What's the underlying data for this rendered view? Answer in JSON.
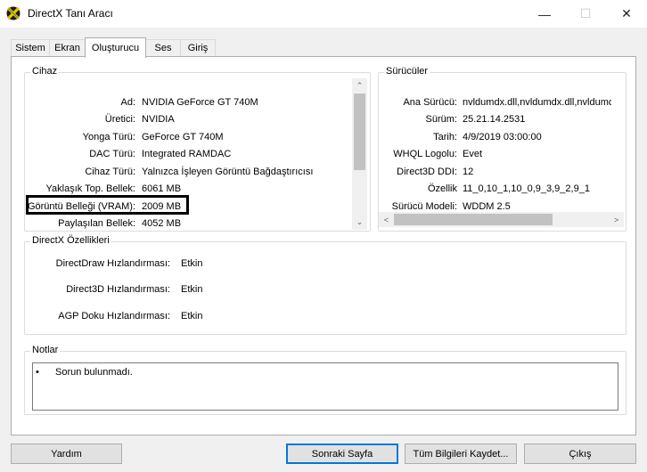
{
  "window": {
    "title": "DirectX Tanı Aracı",
    "minimize_glyph": "—",
    "maximize_glyph": "☐",
    "close_glyph": "✕"
  },
  "tabs": [
    {
      "label": "Sistem"
    },
    {
      "label": "Ekran"
    },
    {
      "label": "Oluşturucu"
    },
    {
      "label": "Ses"
    },
    {
      "label": "Giriş"
    }
  ],
  "active_tab": "Oluşturucu",
  "device": {
    "title": "Cihaz",
    "rows": [
      {
        "label": "Ad:",
        "value": "NVIDIA GeForce GT 740M"
      },
      {
        "label": "Üretici:",
        "value": "NVIDIA"
      },
      {
        "label": "Yonga Türü:",
        "value": "GeForce GT 740M"
      },
      {
        "label": "DAC Türü:",
        "value": "Integrated RAMDAC"
      },
      {
        "label": "Cihaz Türü:",
        "value": "Yalnızca İşleyen Görüntü Bağdaştırıcısı"
      },
      {
        "label": "Yaklaşık Top. Bellek:",
        "value": "6061 MB"
      },
      {
        "label": "Görüntü Belleği (VRAM):",
        "value": "2009 MB"
      },
      {
        "label": "Paylaşılan Bellek:",
        "value": "4052 MB"
      }
    ]
  },
  "drivers": {
    "title": "Sürücüler",
    "rows": [
      {
        "label": "Ana Sürücü:",
        "value": "nvldumdx.dll,nvldumdx.dll,nvldumdx.d"
      },
      {
        "label": "Sürüm:",
        "value": "25.21.14.2531"
      },
      {
        "label": "Tarih:",
        "value": "4/9/2019 03:00:00"
      },
      {
        "label": "WHQL Logolu:",
        "value": "Evet"
      },
      {
        "label": "Direct3D DDI:",
        "value": "12"
      },
      {
        "label": "Özellik",
        "value": "11_0,10_1,10_0,9_3,9_2,9_1"
      },
      {
        "label": "Sürücü Modeli:",
        "value": "WDDM 2.5"
      }
    ]
  },
  "features": {
    "title": "DirectX Özellikleri",
    "rows": [
      {
        "label": "DirectDraw Hızlandırması:",
        "value": "Etkin"
      },
      {
        "label": "Direct3D Hızlandırması:",
        "value": "Etkin"
      },
      {
        "label": "AGP Doku Hızlandırması:",
        "value": "Etkin"
      }
    ]
  },
  "notes": {
    "title": "Notlar",
    "bullet": "•",
    "items": [
      "Sorun bulunmadı."
    ]
  },
  "buttons": {
    "help": "Yardım",
    "next_page": "Sonraki Sayfa",
    "save_all": "Tüm Bilgileri Kaydet...",
    "exit": "Çıkış"
  },
  "scroll_glyphs": {
    "up": "⌃",
    "down": "⌄",
    "left": "<",
    "right": ">"
  },
  "colors": {
    "accent": "#0078d7",
    "highlight_border": "#000000"
  }
}
